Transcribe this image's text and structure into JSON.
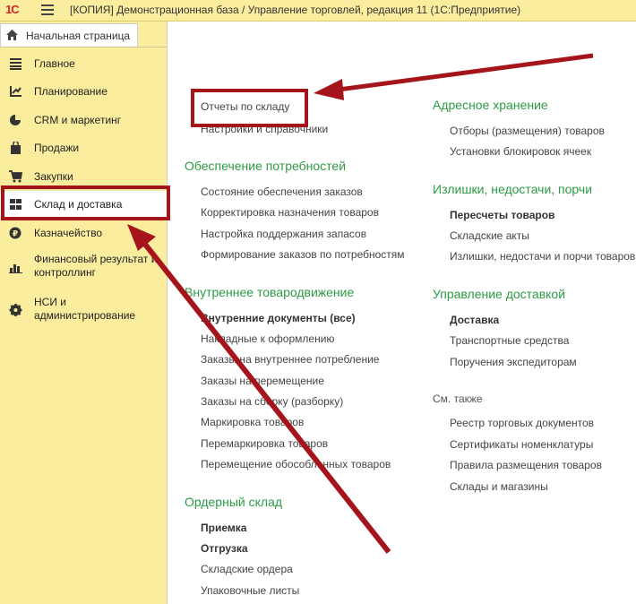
{
  "app": {
    "logo": "1С",
    "title": "[КОПИЯ] Демонстрационная база / Управление торговлей, редакция 11  (1С:Предприятие)"
  },
  "sidebar": {
    "home_label": "Начальная страница",
    "items": [
      {
        "label": "Главное",
        "icon": "list-icon"
      },
      {
        "label": "Планирование",
        "icon": "planning-icon"
      },
      {
        "label": "CRM и маркетинг",
        "icon": "pie-chart-icon"
      },
      {
        "label": "Продажи",
        "icon": "shopping-bag-icon"
      },
      {
        "label": "Закупки",
        "icon": "cart-icon"
      },
      {
        "label": "Склад и доставка",
        "icon": "warehouse-icon",
        "active": true
      },
      {
        "label": "Казначейство",
        "icon": "ruble-icon"
      },
      {
        "label": "Финансовый результат и контроллинг",
        "icon": "bar-chart-icon"
      },
      {
        "label": "НСИ и администрирование",
        "icon": "gear-icon"
      }
    ]
  },
  "left": {
    "top_links": [
      "Отчеты по складу",
      "Настройки и справочники"
    ],
    "g1": {
      "title": "Обеспечение потребностей",
      "links": [
        "Состояние обеспечения заказов",
        "Корректировка назначения товаров",
        "Настройка поддержания запасов",
        "Формирование заказов по потребностям"
      ]
    },
    "g2": {
      "title": "Внутреннее товародвижение",
      "bold": "Внутренние документы (все)",
      "links": [
        "Накладные к оформлению",
        "Заказы на внутреннее потребление",
        "Заказы на перемещение",
        "Заказы на сборку (разборку)",
        "Маркировка товаров",
        "Перемаркировка товаров",
        "Перемещение обособленных товаров"
      ]
    },
    "g3": {
      "title": "Ордерный склад",
      "bold": [
        "Приемка",
        "Отгрузка"
      ],
      "links": [
        "Складские ордера",
        "Упаковочные листы"
      ]
    }
  },
  "right": {
    "g1": {
      "title": "Адресное хранение",
      "links": [
        "Отборы (размещения) товаров",
        "Установки блокировок ячеек"
      ]
    },
    "g2": {
      "title": "Излишки, недостачи, порчи",
      "bold": "Пересчеты товаров",
      "links": [
        "Складские акты",
        "Излишки, недостачи и порчи товаров"
      ]
    },
    "g3": {
      "title": "Управление доставкой",
      "bold": "Доставка",
      "links": [
        "Транспортные средства",
        "Поручения экспедиторам"
      ]
    },
    "see_also": {
      "title": "См. также",
      "links": [
        "Реестр торговых документов",
        "Сертификаты номенклатуры",
        "Правила размещения товаров",
        "Склады и магазины"
      ]
    }
  },
  "colors": {
    "accent_green": "#2d9a44",
    "annotation_red": "#a5141b",
    "panel_yellow": "#fbed9e"
  }
}
